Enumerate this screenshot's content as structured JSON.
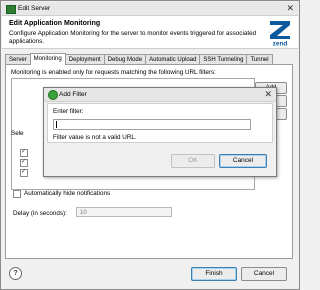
{
  "window": {
    "title": "Edit Server",
    "close_symbol": "✕"
  },
  "header": {
    "title": "Edit Application Monitoring",
    "description": "Configure Application Monitoring for the server to monitor events triggered for associated applications.",
    "logo_text": "zend"
  },
  "tabs": [
    {
      "label": "Server",
      "active": false
    },
    {
      "label": "Monitoring",
      "active": true
    },
    {
      "label": "Deployment",
      "active": false
    },
    {
      "label": "Debug Mode",
      "active": false
    },
    {
      "label": "Automatic Upload",
      "active": false
    },
    {
      "label": "SSH Tunneling",
      "active": false
    },
    {
      "label": "Tunnel",
      "active": false
    }
  ],
  "monitoring": {
    "filters_label": "Monitoring is enabled only for requests matching the following URL filters:",
    "add_button": "Add",
    "select_label": "Sele",
    "auto_hide_label": "Automatically hide notifications",
    "delay_label": "Delay (in seconds):",
    "delay_value": "10"
  },
  "footer": {
    "help_symbol": "?",
    "finish_label": "Finish",
    "cancel_label": "Cancel"
  },
  "dialog": {
    "title": "Add Filter",
    "close_symbol": "✕",
    "field_label": "Enter filter:",
    "value": "",
    "error": "Filter value is not a valid URL.",
    "ok_label": "OK",
    "cancel_label": "Cancel"
  },
  "colors": {
    "logo": "#0b5a9e",
    "dialog_icon": "#3aa23a",
    "default_button_border": "#3c7fb1"
  },
  "icons": {
    "window": "server-icon",
    "dialog": "green-circle-icon",
    "help": "help-icon"
  }
}
